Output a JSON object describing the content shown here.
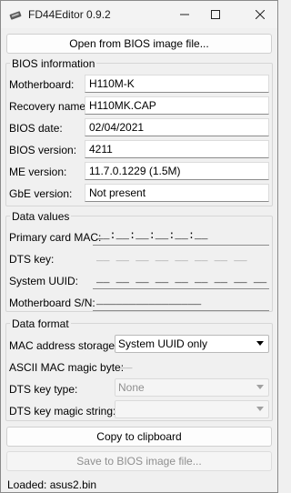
{
  "window": {
    "title": "FD44Editor 0.9.2",
    "icon": "fd44editor-app-icon"
  },
  "buttons": {
    "open": "Open from BIOS image file...",
    "copy": "Copy to clipboard",
    "save": "Save to BIOS image file..."
  },
  "bios_info": {
    "title": "BIOS information",
    "rows": [
      {
        "label": "Motherboard:",
        "value": "H110M-K"
      },
      {
        "label": "Recovery name:",
        "value": "H110MK.CAP"
      },
      {
        "label": "BIOS date:",
        "value": "02/04/2021"
      },
      {
        "label": "BIOS version:",
        "value": "4211"
      },
      {
        "label": "ME version:",
        "value": "11.7.0.1229 (1.5M)"
      },
      {
        "label": "GbE version:",
        "value": "Not present"
      }
    ]
  },
  "data_values": {
    "title": "Data values",
    "primary_mac": {
      "label": "Primary card MAC:",
      "value": "__:__:__:__:__:__"
    },
    "dts_key": {
      "label": "DTS key:",
      "value": "__ __ __ __ __ __ __ __"
    },
    "system_uuid": {
      "label": "System UUID:",
      "value": "__ __ __ __ __ __ __ __ __ __ __"
    },
    "mb_sn": {
      "label": "Motherboard S/N:",
      "value": "________________"
    }
  },
  "data_format": {
    "title": "Data format",
    "mac_storage": {
      "label": "MAC address storage:",
      "value": "System UUID only"
    },
    "ascii_magic": {
      "label": "ASCII MAC magic byte:",
      "value": "__"
    },
    "dts_key_type": {
      "label": "DTS key type:",
      "value": "None"
    },
    "dts_magic": {
      "label": "DTS key magic string:",
      "value": ""
    }
  },
  "status": {
    "text": "Loaded: asus2.bin"
  }
}
